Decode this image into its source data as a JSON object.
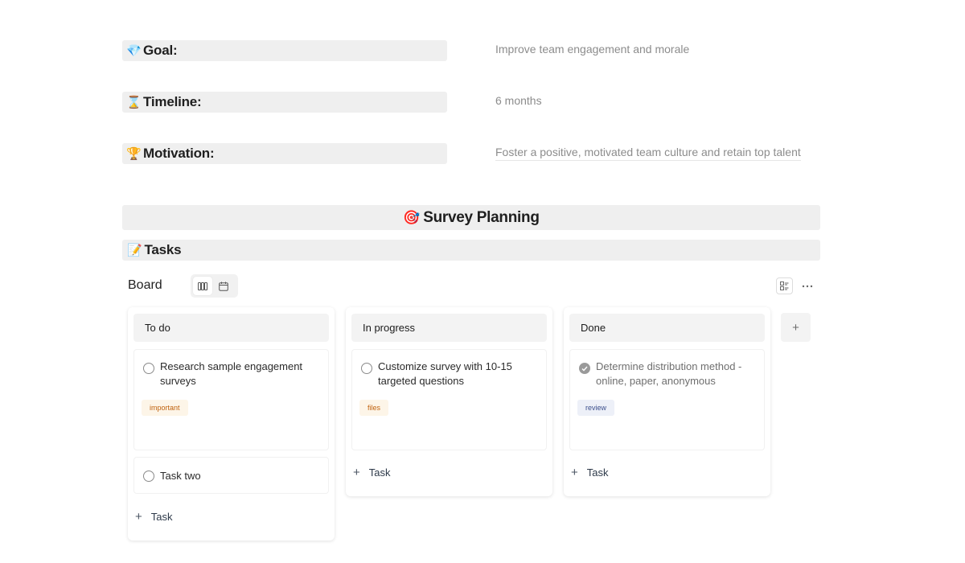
{
  "properties": [
    {
      "emoji": "💎",
      "label": "Goal:",
      "value": "Improve team engagement and morale"
    },
    {
      "emoji": "⌛",
      "label": "Timeline:",
      "value": "6 months"
    },
    {
      "emoji": "🏆",
      "label": "Motivation:",
      "value": "Foster a positive, motivated team culture and retain top talent"
    }
  ],
  "section": {
    "emoji": "🎯",
    "title": "Survey Planning"
  },
  "tasks_header": {
    "emoji": "📝",
    "title": "Tasks"
  },
  "board": {
    "label": "Board",
    "views": [
      "board-view",
      "calendar-view"
    ],
    "active_view": "board-view"
  },
  "columns": [
    {
      "title": "To do",
      "cards": [
        {
          "title": "Research sample engagement surveys",
          "tag": "important",
          "done": false
        },
        {
          "title": "Task two",
          "tag": "",
          "done": false
        }
      ],
      "add_label": "Task"
    },
    {
      "title": "In progress",
      "cards": [
        {
          "title": "Customize survey with 10-15 targeted questions",
          "tag": "files",
          "done": false
        }
      ],
      "add_label": "Task"
    },
    {
      "title": "Done",
      "cards": [
        {
          "title": "Determine distribution method - online, paper, anonymous",
          "tag": "review",
          "done": true
        }
      ],
      "add_label": "Task"
    }
  ],
  "colors": {
    "tag_important_bg": "#fdf5e8",
    "tag_important_text": "#c0620e",
    "tag_files_bg": "#fdf5e8",
    "tag_files_text": "#c0620e",
    "tag_review_bg": "#edf0f8",
    "tag_review_text": "#3b4f8c"
  },
  "add_column_label": "+"
}
